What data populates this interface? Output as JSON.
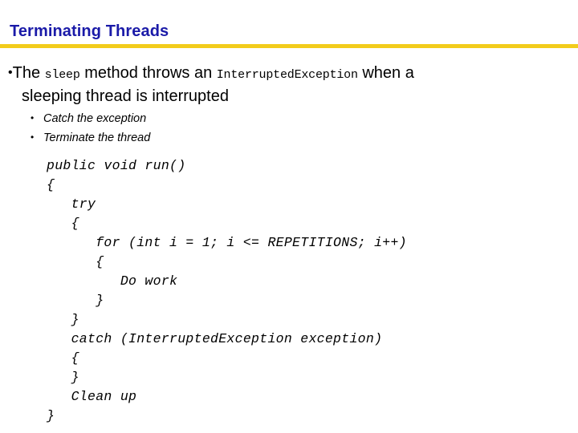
{
  "slide": {
    "title": "Terminating Threads",
    "title_color": "#1A1AA8",
    "rule_color": "#F2CC1B",
    "background_color": "#FFFFFF",
    "text_color": "#000000"
  },
  "bullets": {
    "marker": "•",
    "main": {
      "segment_1": "The ",
      "segment_2_mono": "sleep",
      "segment_3": " method throws an ",
      "segment_4_mono": "InterruptedException",
      "segment_5": " when a",
      "line_2": "sleeping thread is interrupted"
    },
    "sub_items": [
      {
        "marker": "•",
        "label": "Catch the exception"
      },
      {
        "marker": "•",
        "label": "Terminate the thread"
      }
    ]
  },
  "code": {
    "lines": [
      "public void run()",
      "{",
      "   try",
      "   {",
      "      for (int i = 1; i <= REPETITIONS; i++)",
      "      {",
      "         Do work",
      "      }",
      "   }",
      "   catch (InterruptedException exception)",
      "   {",
      "   }",
      "   Clean up",
      "}"
    ]
  }
}
